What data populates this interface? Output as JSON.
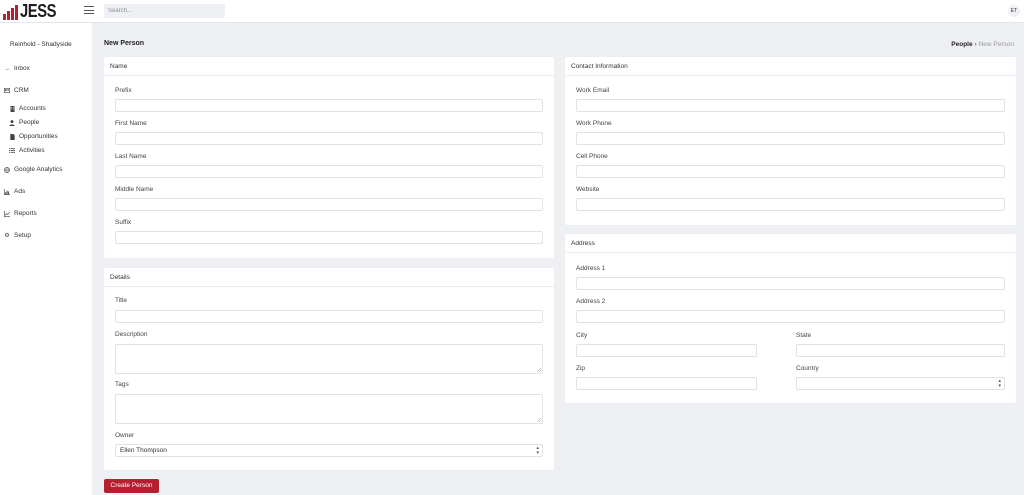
{
  "app": {
    "logo_text": "JESS",
    "brand_color": "#b52031"
  },
  "topbar": {
    "search_placeholder": "Search...",
    "user_initials": "ET"
  },
  "sidebar": {
    "org_name": "Reinhold - Shadyside",
    "items": [
      {
        "label": "Inbox",
        "icon": "arrow-right-icon"
      },
      {
        "label": "CRM",
        "icon": "id-card-icon"
      },
      {
        "label": "Accounts",
        "icon": "building-icon"
      },
      {
        "label": "People",
        "icon": "user-icon"
      },
      {
        "label": "Opportunities",
        "icon": "file-icon"
      },
      {
        "label": "Activities",
        "icon": "list-icon"
      },
      {
        "label": "Google Analytics",
        "icon": "globe-icon"
      },
      {
        "label": "Ads",
        "icon": "chart-icon"
      },
      {
        "label": "Reports",
        "icon": "line-chart-icon"
      },
      {
        "label": "Setup",
        "icon": "gear-icon"
      }
    ]
  },
  "page": {
    "title": "New Person",
    "breadcrumb": {
      "parent": "People",
      "current": "New Person"
    }
  },
  "name_card": {
    "title": "Name",
    "prefix_label": "Prefix",
    "first_name_label": "First Name",
    "last_name_label": "Last Name",
    "middle_name_label": "Middle Name",
    "suffix_label": "Suffix"
  },
  "details_card": {
    "title": "Details",
    "title_label": "Title",
    "description_label": "Description",
    "tags_label": "Tags",
    "owner_label": "Owner",
    "owner_value": "Ellen Thompson"
  },
  "contact_card": {
    "title": "Contact Information",
    "work_email_label": "Work Email",
    "work_phone_label": "Work Phone",
    "cell_phone_label": "Cell Phone",
    "website_label": "Website"
  },
  "address_card": {
    "title": "Address",
    "address1_label": "Address 1",
    "address2_label": "Address 2",
    "city_label": "City",
    "state_label": "State",
    "zip_label": "Zip",
    "country_label": "Country",
    "country_value": ""
  },
  "actions": {
    "create_label": "Create Person"
  }
}
